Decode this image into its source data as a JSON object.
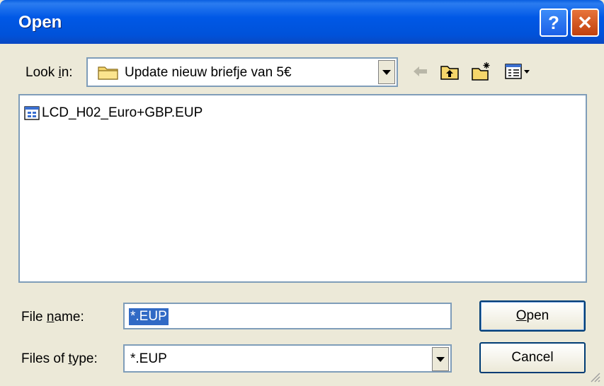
{
  "window": {
    "title": "Open"
  },
  "titlebar": {
    "help_glyph": "?",
    "close_glyph": "✕"
  },
  "lookin": {
    "label_pre": "Look ",
    "label_accel": "i",
    "label_post": "n:",
    "value": "Update nieuw briefje van 5€",
    "icon": "folder-icon"
  },
  "toolbar": {
    "icons": [
      "back-arrow-icon",
      "up-folder-icon",
      "new-folder-icon",
      "view-menu-icon"
    ]
  },
  "files": [
    {
      "name": "LCD_H02_Euro+GBP.EUP",
      "icon": "file-icon"
    }
  ],
  "filename": {
    "label_pre": "File ",
    "label_accel": "n",
    "label_post": "ame:",
    "value": "*.EUP"
  },
  "filetype": {
    "label_pre": "Files of ",
    "label_accel": "t",
    "label_post": "ype:",
    "value": "*.EUP"
  },
  "buttons": {
    "open_accel": "O",
    "open_rest": "pen",
    "cancel": "Cancel"
  },
  "colors": {
    "titlebar": "#0058e6",
    "selection": "#316ac5",
    "face": "#ece9d8",
    "border": "#7f9db9"
  }
}
